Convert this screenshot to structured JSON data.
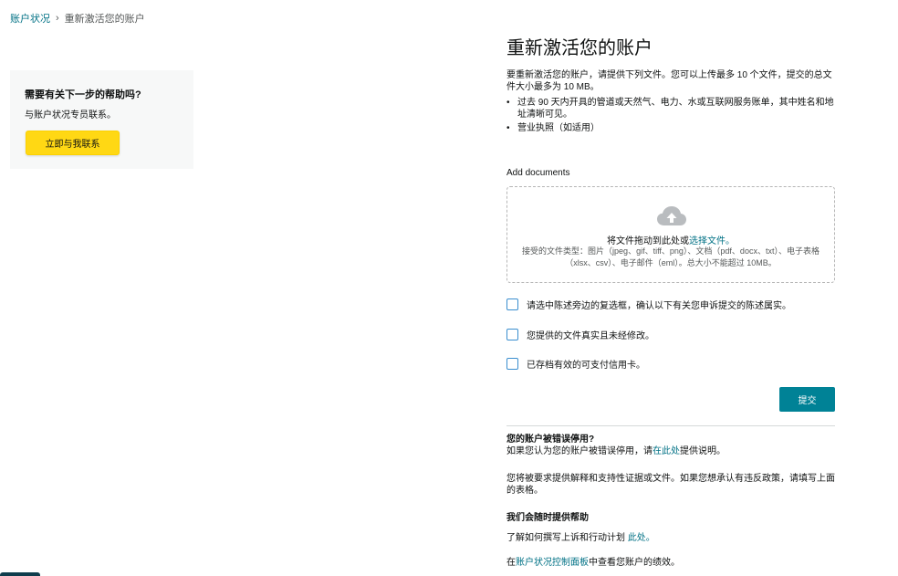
{
  "breadcrumb": {
    "root": "账户状况",
    "separator": "›",
    "current": "重新激活您的账户"
  },
  "help_card": {
    "title": "需要有关下一步的帮助吗?",
    "description": "与账户状况专员联系。",
    "button_label": "立即与我联系"
  },
  "main": {
    "title": "重新激活您的账户",
    "intro": "要重新激活您的账户，请提供下列文件。您可以上传最多 10 个文件，提交的总文件大小最多为 10 MB。",
    "requirements": [
      "过去 90 天内开具的管道或天然气、电力、水或互联网服务账单，其中姓名和地址清晰可见。",
      "营业执照（如适用）"
    ]
  },
  "upload": {
    "label": "Add documents",
    "icon": "cloud-upload-icon",
    "drop_text": "将文件拖动到此处或",
    "select_link": "选择文件。",
    "accepted_types": "接受的文件类型：图片（jpeg、gif、tiff、png）、文档（pdf、docx、txt）、电子表格（xlsx、csv）、电子邮件（eml）。总大小不能超过 10MB。"
  },
  "checkboxes": [
    {
      "label": "请选中陈述旁边的复选框，确认以下有关您申诉提交的陈述属实。",
      "checked": false
    },
    {
      "label": "您提供的文件真实且未经修改。",
      "checked": false
    },
    {
      "label": "已存档有效的可支付信用卡。",
      "checked": false
    }
  ],
  "submit_label": "提交",
  "faq": {
    "wrong_suspend_title": "您的账户被错误停用?",
    "wrong_suspend_text_before": "如果您认为您的账户被错误停用，请",
    "wrong_suspend_link": "在此处",
    "wrong_suspend_text_after": "提供说明。",
    "policy_text": "您将被要求提供解释和支持性证据或文件。如果您想承认有违反政策，请填写上面的表格。",
    "help_title": "我们会随时提供帮助",
    "appeal_text_before": "了解如何撰写上诉和行动计划 ",
    "appeal_link": "此处。",
    "dashboard_text_before": "在",
    "dashboard_link": "账户状况控制面板",
    "dashboard_text_after": "中查看您账户的绩效。"
  },
  "colors": {
    "link": "#007185",
    "primary_button": "#ffd814",
    "submit_button": "#008296",
    "checkbox_border": "#3a8ecf"
  }
}
